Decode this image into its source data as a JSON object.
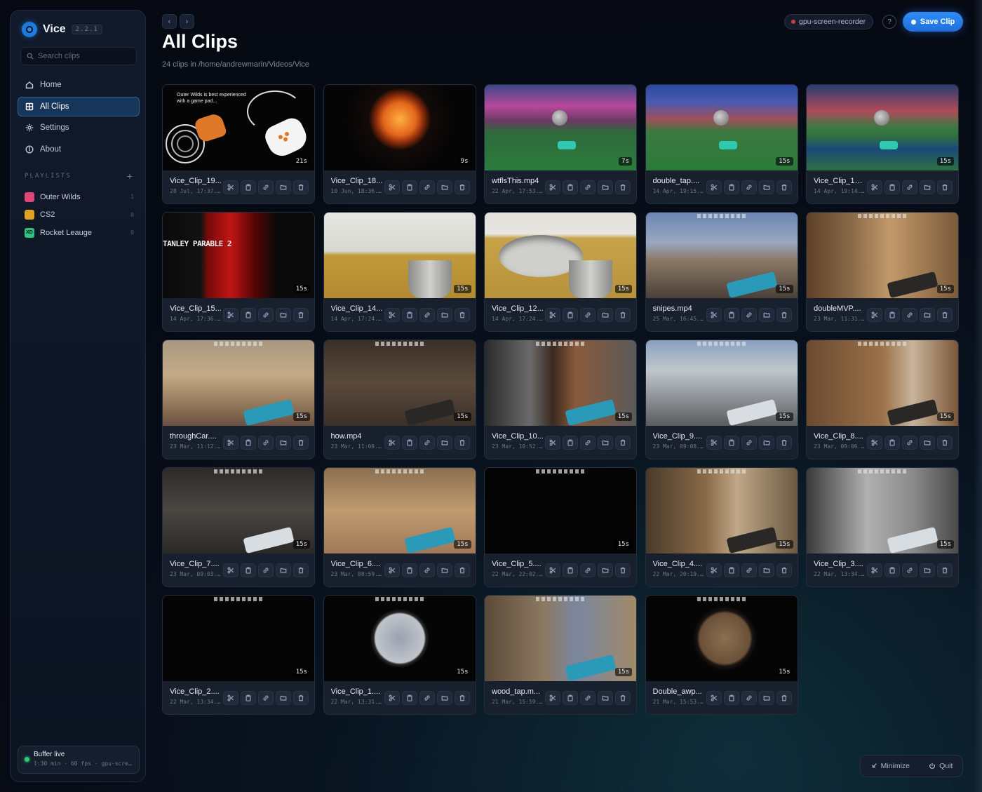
{
  "app": {
    "name": "Vice",
    "version": "2.2.1"
  },
  "search": {
    "placeholder": "Search clips"
  },
  "nav": [
    {
      "label": "Home",
      "icon": "home-icon"
    },
    {
      "label": "All Clips",
      "icon": "grid-icon",
      "active": true
    },
    {
      "label": "Settings",
      "icon": "gear-icon"
    },
    {
      "label": "About",
      "icon": "info-icon"
    }
  ],
  "playlists": {
    "title": "PLAYLISTS",
    "items": [
      {
        "name": "Outer Wilds",
        "count": "1",
        "color": "#e0457a"
      },
      {
        "name": "CS2",
        "count": "0",
        "color": "#e0a020"
      },
      {
        "name": "Rocket Leauge",
        "count": "0",
        "color": "#2ec27e",
        "badge": "XD"
      }
    ]
  },
  "buffer": {
    "title": "Buffer live",
    "sub": "1:30 min · 60 fps · gpu-screen-recorder"
  },
  "header": {
    "title": "All Clips",
    "subtitle": "24 clips in /home/andrewmarin/Videos/Vice",
    "recorder": "gpu-screen-recorder",
    "save_label": "Save Clip"
  },
  "ow_caption": "Outer Wilds is best experienced with a game pad...",
  "sp_caption": "TANLEY PARABLE 2",
  "clips": [
    {
      "name": "Vice_Clip_19...",
      "date": "28 Jul, 17:37...",
      "duration": "21s",
      "thumb": "t-ow"
    },
    {
      "name": "Vice_Clip_18...",
      "date": "10 Jun, 18:36...",
      "duration": "9s",
      "thumb": "t-sun"
    },
    {
      "name": "wtflsThis.mp4",
      "date": "22 Apr, 17:53...",
      "duration": "7s",
      "thumb": "t-rl1"
    },
    {
      "name": "double_tap....",
      "date": "14 Apr, 19:15...",
      "duration": "15s",
      "thumb": "t-rl2"
    },
    {
      "name": "Vice_Clip_17....",
      "date": "14 Apr, 19:14...",
      "duration": "15s",
      "thumb": "t-rl3"
    },
    {
      "name": "Vice_Clip_15...",
      "date": "14 Apr, 17:36...",
      "duration": "15s",
      "thumb": "t-sp"
    },
    {
      "name": "Vice_Clip_14...",
      "date": "14 Apr, 17:24...",
      "duration": "15s",
      "thumb": "t-room1"
    },
    {
      "name": "Vice_Clip_12...",
      "date": "14 Apr, 17:24...",
      "duration": "15s",
      "thumb": "t-room2"
    },
    {
      "name": "snipes.mp4",
      "date": "25 Mar, 16:45...",
      "duration": "15s",
      "thumb": "t-snipe"
    },
    {
      "name": "doubleMVP....",
      "date": "23 Mar, 11:31...",
      "duration": "15s",
      "thumb": "t-cs1"
    },
    {
      "name": "throughCar....",
      "date": "23 Mar, 11:12...",
      "duration": "15s",
      "thumb": "t-cs2"
    },
    {
      "name": "how.mp4",
      "date": "23 Mar, 11:06...",
      "duration": "15s",
      "thumb": "t-cs3"
    },
    {
      "name": "Vice_Clip_10...",
      "date": "23 Mar, 10:52...",
      "duration": "15s",
      "thumb": "t-cs4"
    },
    {
      "name": "Vice_Clip_9....",
      "date": "23 Mar, 09:08...",
      "duration": "15s",
      "thumb": "t-cs5"
    },
    {
      "name": "Vice_Clip_8....",
      "date": "23 Mar, 09:06...",
      "duration": "15s",
      "thumb": "t-cs6"
    },
    {
      "name": "Vice_Clip_7....",
      "date": "23 Mar, 09:03...",
      "duration": "15s",
      "thumb": "t-cs7"
    },
    {
      "name": "Vice_Clip_6....",
      "date": "23 Mar, 08:59...",
      "duration": "15s",
      "thumb": "t-cs8"
    },
    {
      "name": "Vice_Clip_5....",
      "date": "22 Mar, 22:02...",
      "duration": "15s",
      "thumb": "t-black"
    },
    {
      "name": "Vice_Clip_4....",
      "date": "22 Mar, 20:19...",
      "duration": "15s",
      "thumb": "t-cs9"
    },
    {
      "name": "Vice_Clip_3....",
      "date": "22 Mar, 13:34...",
      "duration": "15s",
      "thumb": "t-cs10"
    },
    {
      "name": "Vice_Clip_2....",
      "date": "22 Mar, 13:34...",
      "duration": "15s",
      "thumb": "t-black"
    },
    {
      "name": "Vice_Clip_1....",
      "date": "22 Mar, 13:31...",
      "duration": "15s",
      "thumb": "t-scope"
    },
    {
      "name": "wood_tap.m...",
      "date": "21 Mar, 15:59...",
      "duration": "15s",
      "thumb": "t-wood"
    },
    {
      "name": "Double_awp...",
      "date": "21 Mar, 15:53...",
      "duration": "15s",
      "thumb": "t-scope2"
    }
  ],
  "clip_actions": [
    "trim-icon",
    "clipboard-icon",
    "link-icon",
    "folder-icon",
    "trash-icon"
  ],
  "window": {
    "minimize": "Minimize",
    "quit": "Quit"
  }
}
